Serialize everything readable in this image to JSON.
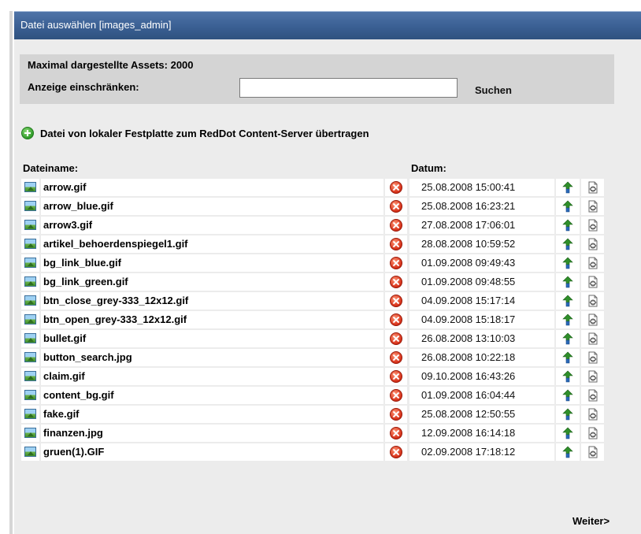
{
  "window": {
    "title": "Datei auswählen [images_admin]"
  },
  "filter": {
    "max_assets": "Maximal dargestellte Assets: 2000",
    "limit_label": "Anzeige einschränken:",
    "search_value": "",
    "search_label": "Suchen"
  },
  "upload": {
    "label": "Datei von lokaler Festplatte zum RedDot Content-Server übertragen"
  },
  "table": {
    "headers": {
      "name": "Dateiname:",
      "date": "Datum:"
    },
    "rows": [
      {
        "name": "arrow.gif",
        "date": "25.08.2008 15:00:41"
      },
      {
        "name": "arrow_blue.gif",
        "date": "25.08.2008 16:23:21"
      },
      {
        "name": "arrow3.gif",
        "date": "27.08.2008 17:06:01"
      },
      {
        "name": "artikel_behoerdenspiegel1.gif",
        "date": "28.08.2008 10:59:52"
      },
      {
        "name": "bg_link_blue.gif",
        "date": "01.09.2008 09:49:43"
      },
      {
        "name": "bg_link_green.gif",
        "date": "01.09.2008 09:48:55"
      },
      {
        "name": "btn_close_grey-333_12x12.gif",
        "date": "04.09.2008 15:17:14"
      },
      {
        "name": "btn_open_grey-333_12x12.gif",
        "date": "04.09.2008 15:18:17"
      },
      {
        "name": "bullet.gif",
        "date": "26.08.2008 13:10:03"
      },
      {
        "name": "button_search.jpg",
        "date": "26.08.2008 10:22:18"
      },
      {
        "name": "claim.gif",
        "date": "09.10.2008 16:43:26"
      },
      {
        "name": "content_bg.gif",
        "date": "01.09.2008 16:04:44"
      },
      {
        "name": "fake.gif",
        "date": "25.08.2008 12:50:55"
      },
      {
        "name": "finanzen.jpg",
        "date": "12.09.2008 16:14:18"
      },
      {
        "name": "gruen(1).GIF",
        "date": "02.09.2008 17:18:12"
      }
    ]
  },
  "icons": {
    "file": "image-file-icon",
    "delete": "delete-icon",
    "action": "transfer-icon",
    "preview": "preview-icon"
  },
  "pagination": {
    "next_label": "Weiter>"
  }
}
